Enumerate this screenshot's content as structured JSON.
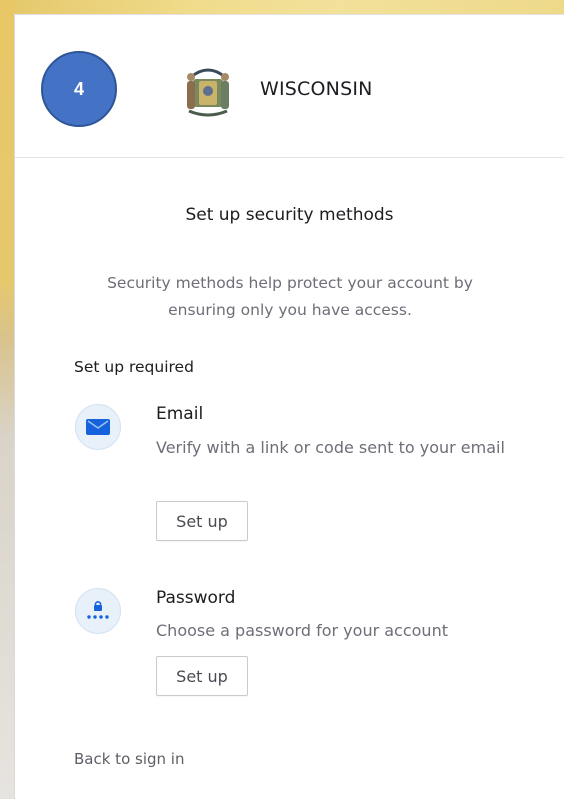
{
  "step_badge": "4",
  "header": {
    "org_name": "WISCONSIN"
  },
  "page": {
    "heading": "Set up security methods",
    "subtitle": "Security methods help protect your account by ensuring only you have access.",
    "section_label": "Set up required"
  },
  "methods": [
    {
      "title": "Email",
      "description": "Verify with a link or code sent to your email",
      "button_label": "Set up",
      "icon": "envelope-icon"
    },
    {
      "title": "Password",
      "description": "Choose a password for your account",
      "button_label": "Set up",
      "icon": "password-lock-icon"
    }
  ],
  "footer": {
    "back_link": "Back to sign in"
  },
  "colors": {
    "badge": "#4472c4",
    "icon_bg": "#e8f1fa",
    "icon_accent": "#1662dd"
  }
}
